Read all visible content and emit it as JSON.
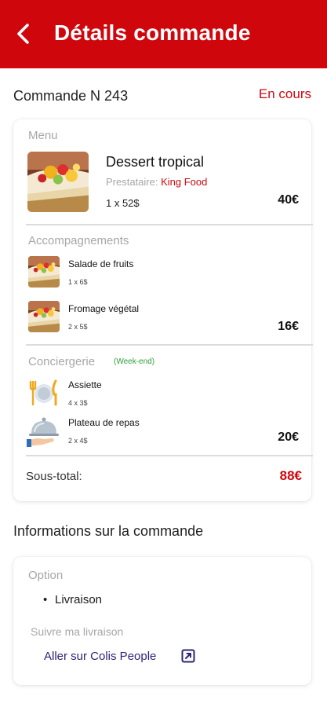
{
  "header": {
    "title": "Détails commande",
    "back_icon": "back-arrow-icon"
  },
  "order": {
    "number_label": "Commande N 243",
    "status": "En cours"
  },
  "menu": {
    "section_label": "Menu",
    "item": {
      "name": "Dessert tropical",
      "provider_label": "Prestataire:",
      "provider_name": "King Food",
      "qty": "1 x 52$",
      "price": "40€"
    }
  },
  "sides": {
    "section_label": "Accompagnements",
    "items": [
      {
        "name": "Salade de fruits",
        "qty": "1 x 6$"
      },
      {
        "name": "Fromage végétal",
        "qty": "2 x 5$"
      }
    ],
    "price": "16€"
  },
  "concierge": {
    "section_label": "Conciergerie",
    "badge": "(Week-end)",
    "items": [
      {
        "name": "Assiette",
        "qty": "4 x 3$",
        "icon": "plate-cutlery-icon"
      },
      {
        "name": "Plateau de repas",
        "qty": "2 x 4$",
        "icon": "serving-tray-icon"
      }
    ],
    "price": "20€"
  },
  "subtotal": {
    "label": "Sous-total:",
    "value": "88€"
  },
  "info": {
    "title": "Informations sur la commande",
    "option_label": "Option",
    "bullet": "•",
    "option_value": "Livraison",
    "track_label": "Suivre ma livraison",
    "track_link": "Aller sur Colis People",
    "external_icon": "external-link-icon"
  },
  "colors": {
    "brand_red": "#d0060d",
    "badge_green": "#2e9e3a",
    "link_blue": "#2c2575"
  }
}
